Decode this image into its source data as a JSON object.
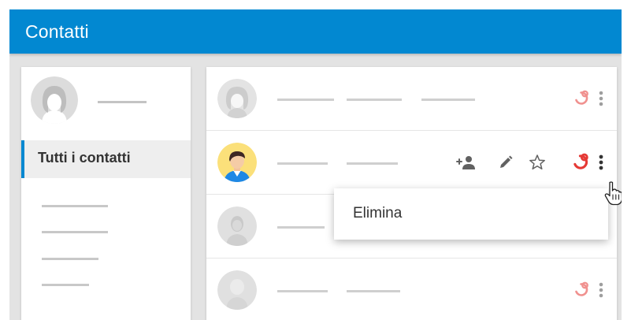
{
  "header": {
    "title": "Contatti",
    "color": "#0288d1"
  },
  "sidebar": {
    "selected_item": "Tutti i contatti",
    "accent_color": "#0288d1"
  },
  "contacts_list": {
    "rows": [
      {
        "avatar": "placeholder-woman-avatar",
        "state": "inactive"
      },
      {
        "avatar": "man-cartoon-avatar",
        "state": "hovered",
        "actions": [
          "add-person-icon",
          "edit-pencil-icon",
          "star-outline-icon",
          "merge-icon",
          "more-vert-icon"
        ]
      },
      {
        "avatar": "placeholder-avatar",
        "state": "inactive"
      },
      {
        "avatar": "placeholder-avatar",
        "state": "inactive"
      }
    ],
    "merge_icon_color": "#e53935"
  },
  "context_menu": {
    "items": [
      "Elimina"
    ]
  },
  "cursor": "hand-pointer-icon"
}
